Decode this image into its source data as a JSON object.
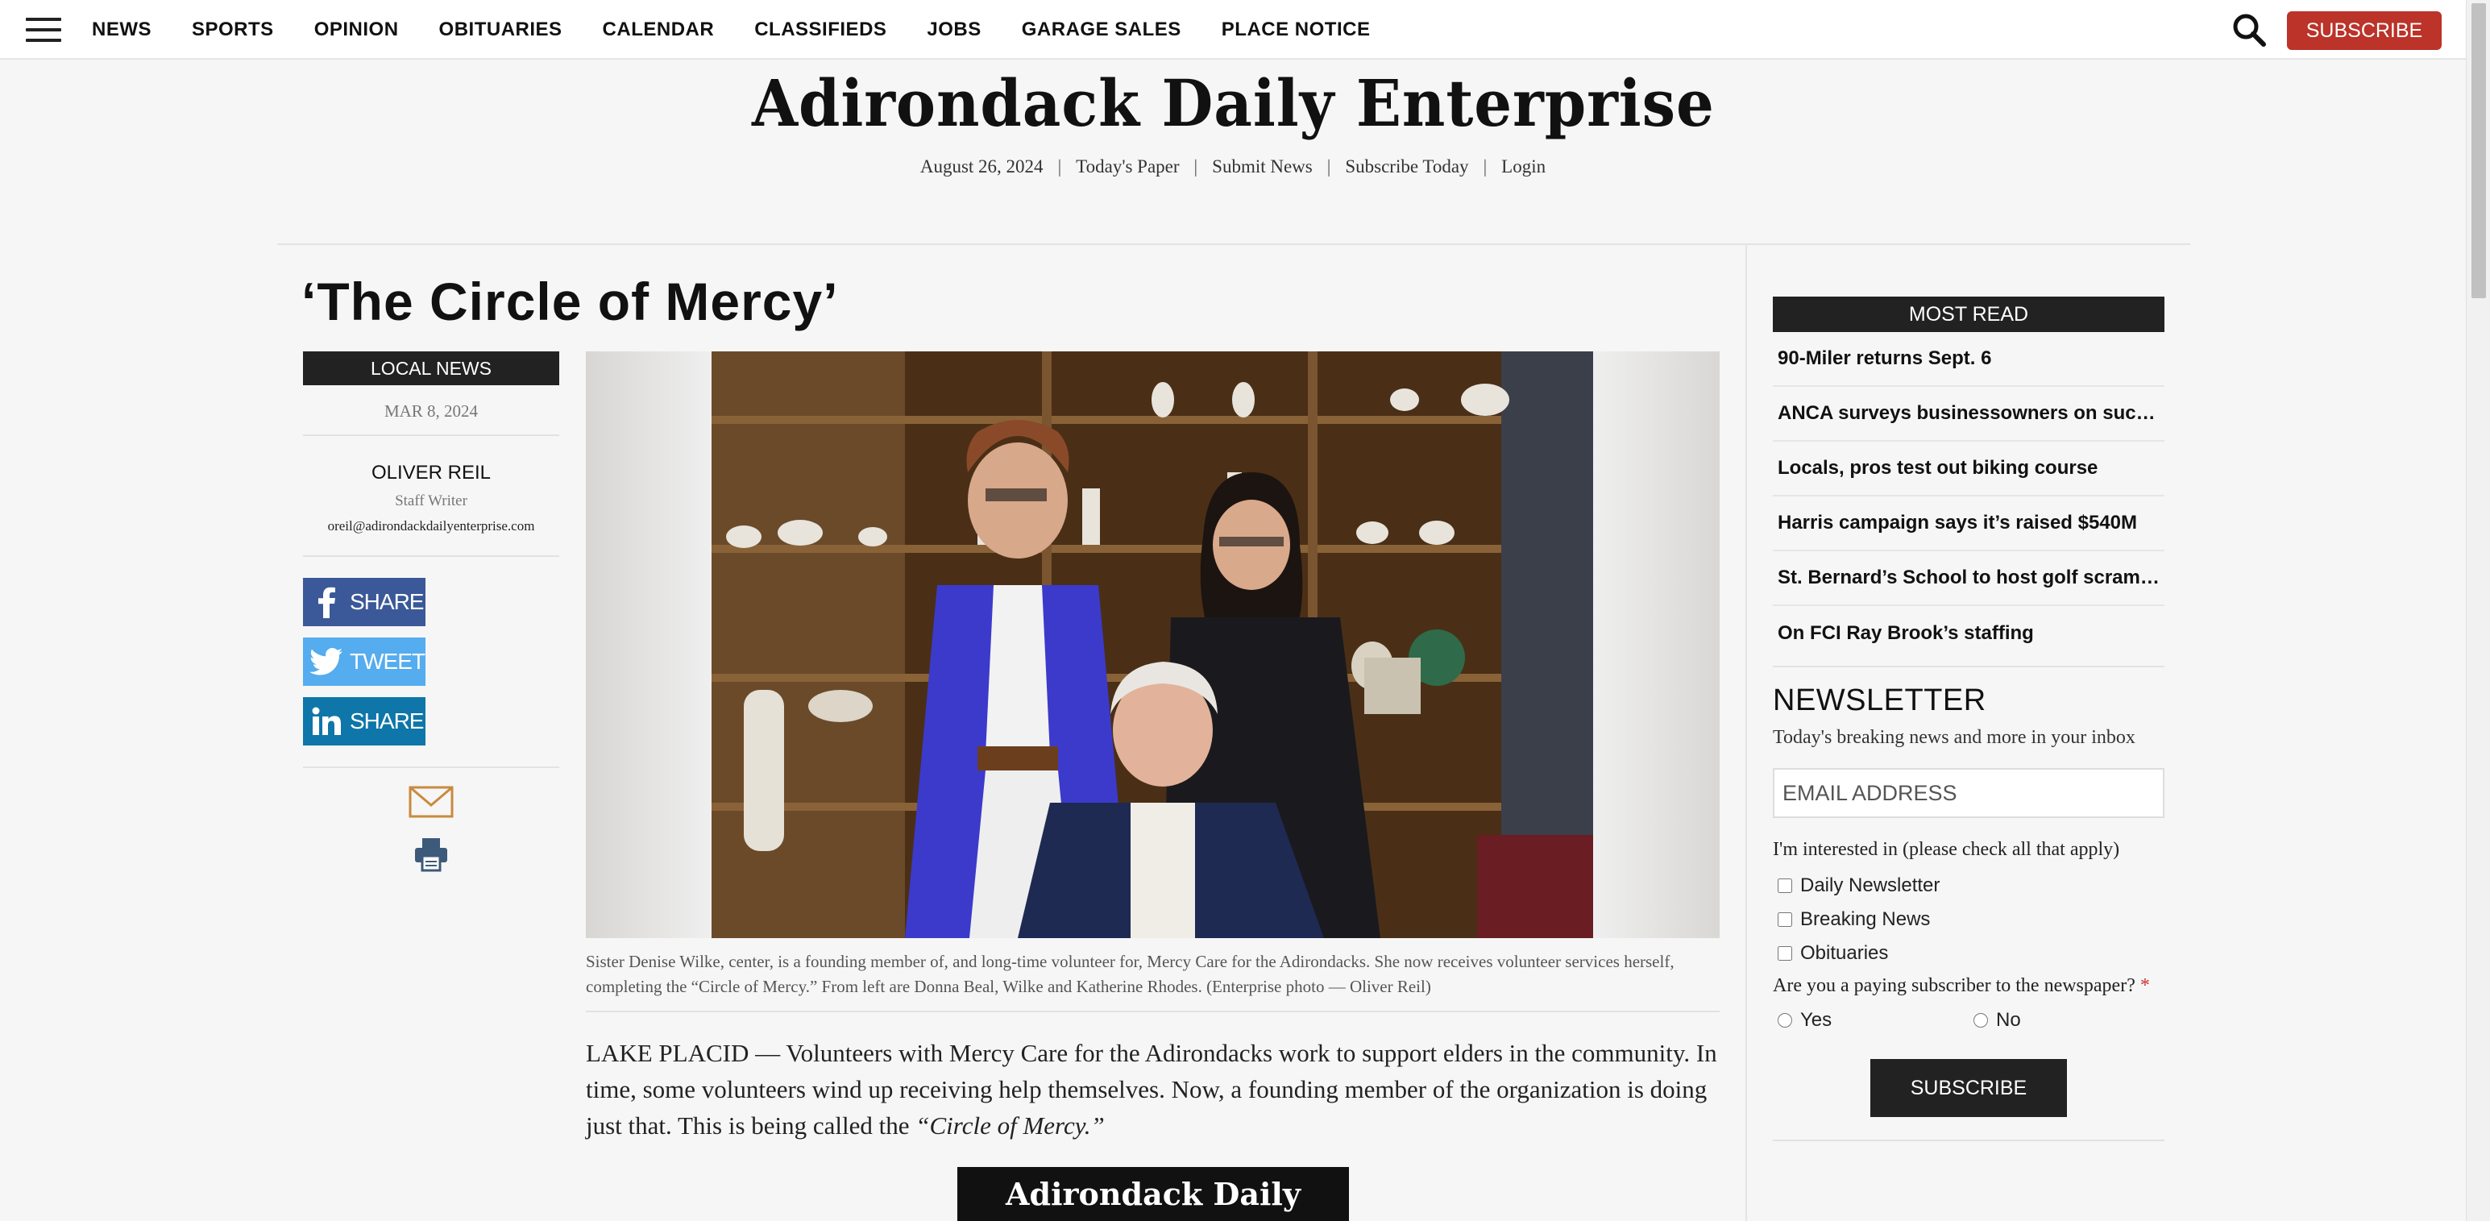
{
  "nav": {
    "links": [
      "NEWS",
      "SPORTS",
      "OPINION",
      "OBITUARIES",
      "CALENDAR",
      "CLASSIFIEDS",
      "JOBS",
      "GARAGE SALES",
      "PLACE NOTICE"
    ],
    "subscribe_label": "SUBSCRIBE"
  },
  "masthead": {
    "logo_text": "Adirondack Daily Enterprise",
    "date": "August 26, 2024",
    "links": [
      "Today's Paper",
      "Submit News",
      "Subscribe Today",
      "Login"
    ]
  },
  "article": {
    "headline": "‘The Circle of Mercy’",
    "category": "LOCAL NEWS",
    "date": "MAR 8, 2024",
    "author": "OLIVER REIL",
    "author_role": "Staff Writer",
    "author_email": "oreil@adirondackdailyenterprise.com",
    "share": {
      "facebook": "SHARE",
      "twitter": "TWEET",
      "linkedin": "SHARE"
    },
    "caption": "Sister Denise Wilke, center, is a founding member of, and long-time volunteer for, Mercy Care for the Adirondacks. She now receives volunteer services herself, completing the “Circle of Mercy.” From left are Donna Beal, Wilke and Katherine Rhodes. (Enterprise photo — Oliver Reil)",
    "body_lead": "LAKE PLACID — Volunteers with Mercy Care for the Adirondacks work to support elders in the community. In time, some volunteers wind up receiving help themselves. Now, a founding member of the organization is doing just that. This is being called the ",
    "body_em": "“Circle of Mercy.”",
    "ad_logo": "Adirondack Daily Enterprise"
  },
  "most_read": {
    "title": "MOST READ",
    "items": [
      "90-Miler returns Sept. 6",
      "ANCA surveys businessowners on succession",
      "Locals, pros test out biking course",
      "Harris campaign says it’s raised $540M",
      "St. Bernard’s School to host golf scramble",
      "On FCI Ray Brook’s staffing"
    ]
  },
  "newsletter": {
    "title": "NEWSLETTER",
    "subtitle": "Today's breaking news and more in your inbox",
    "email_placeholder": "EMAIL ADDRESS",
    "interest_label": "I'm interested in (please check all that apply)",
    "options": [
      "Daily Newsletter",
      "Breaking News",
      "Obituaries"
    ],
    "paying_question": "Are you a paying subscriber to the newspaper?",
    "required_mark": "*",
    "radio_yes": "Yes",
    "radio_no": "No",
    "submit_label": "SUBSCRIBE"
  },
  "colors": {
    "subscribe_red": "#bb3329",
    "dark_bar": "#222222",
    "facebook": "#3b5998",
    "twitter": "#55acee",
    "linkedin": "#0e76a8"
  }
}
